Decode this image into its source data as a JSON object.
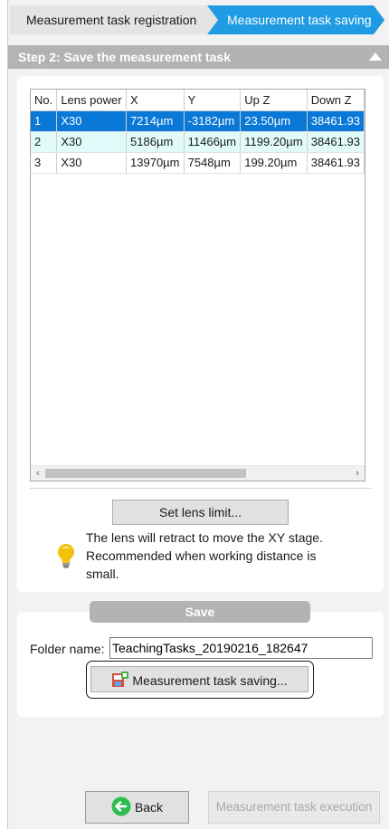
{
  "steps": {
    "registration": "Measurement task registration",
    "saving": "Measurement task saving"
  },
  "section": {
    "title": "Step 2: Save the measurement task"
  },
  "table": {
    "columns": [
      "No.",
      "Lens power",
      "X",
      "Y",
      "Up Z",
      "Down Z"
    ],
    "rows": [
      [
        "1",
        "X30",
        "7214µm",
        "-3182µm",
        "23.50µm",
        "38461.93"
      ],
      [
        "2",
        "X30",
        "5186µm",
        "11466µm",
        "1199.20µm",
        "38461.93"
      ],
      [
        "3",
        "X30",
        "13970µm",
        "7548µm",
        "199.20µm",
        "38461.93"
      ]
    ]
  },
  "lens": {
    "button": "Set lens limit...",
    "note": "The lens will retract to move the XY stage. Recommended when working distance is small."
  },
  "save": {
    "header": "Save",
    "folder_label": "Folder name:",
    "folder_value": "TeachingTasks_20190216_182647",
    "button": "Measurement task saving..."
  },
  "footer": {
    "back": "Back",
    "execute": "Measurement task execution"
  },
  "colors": {
    "accent": "#1e9be3",
    "selected_row": "#0a78d7",
    "hover_row": "#e1fbfb",
    "bulb": "#f4c20d",
    "back_icon": "#2ebd4f"
  }
}
